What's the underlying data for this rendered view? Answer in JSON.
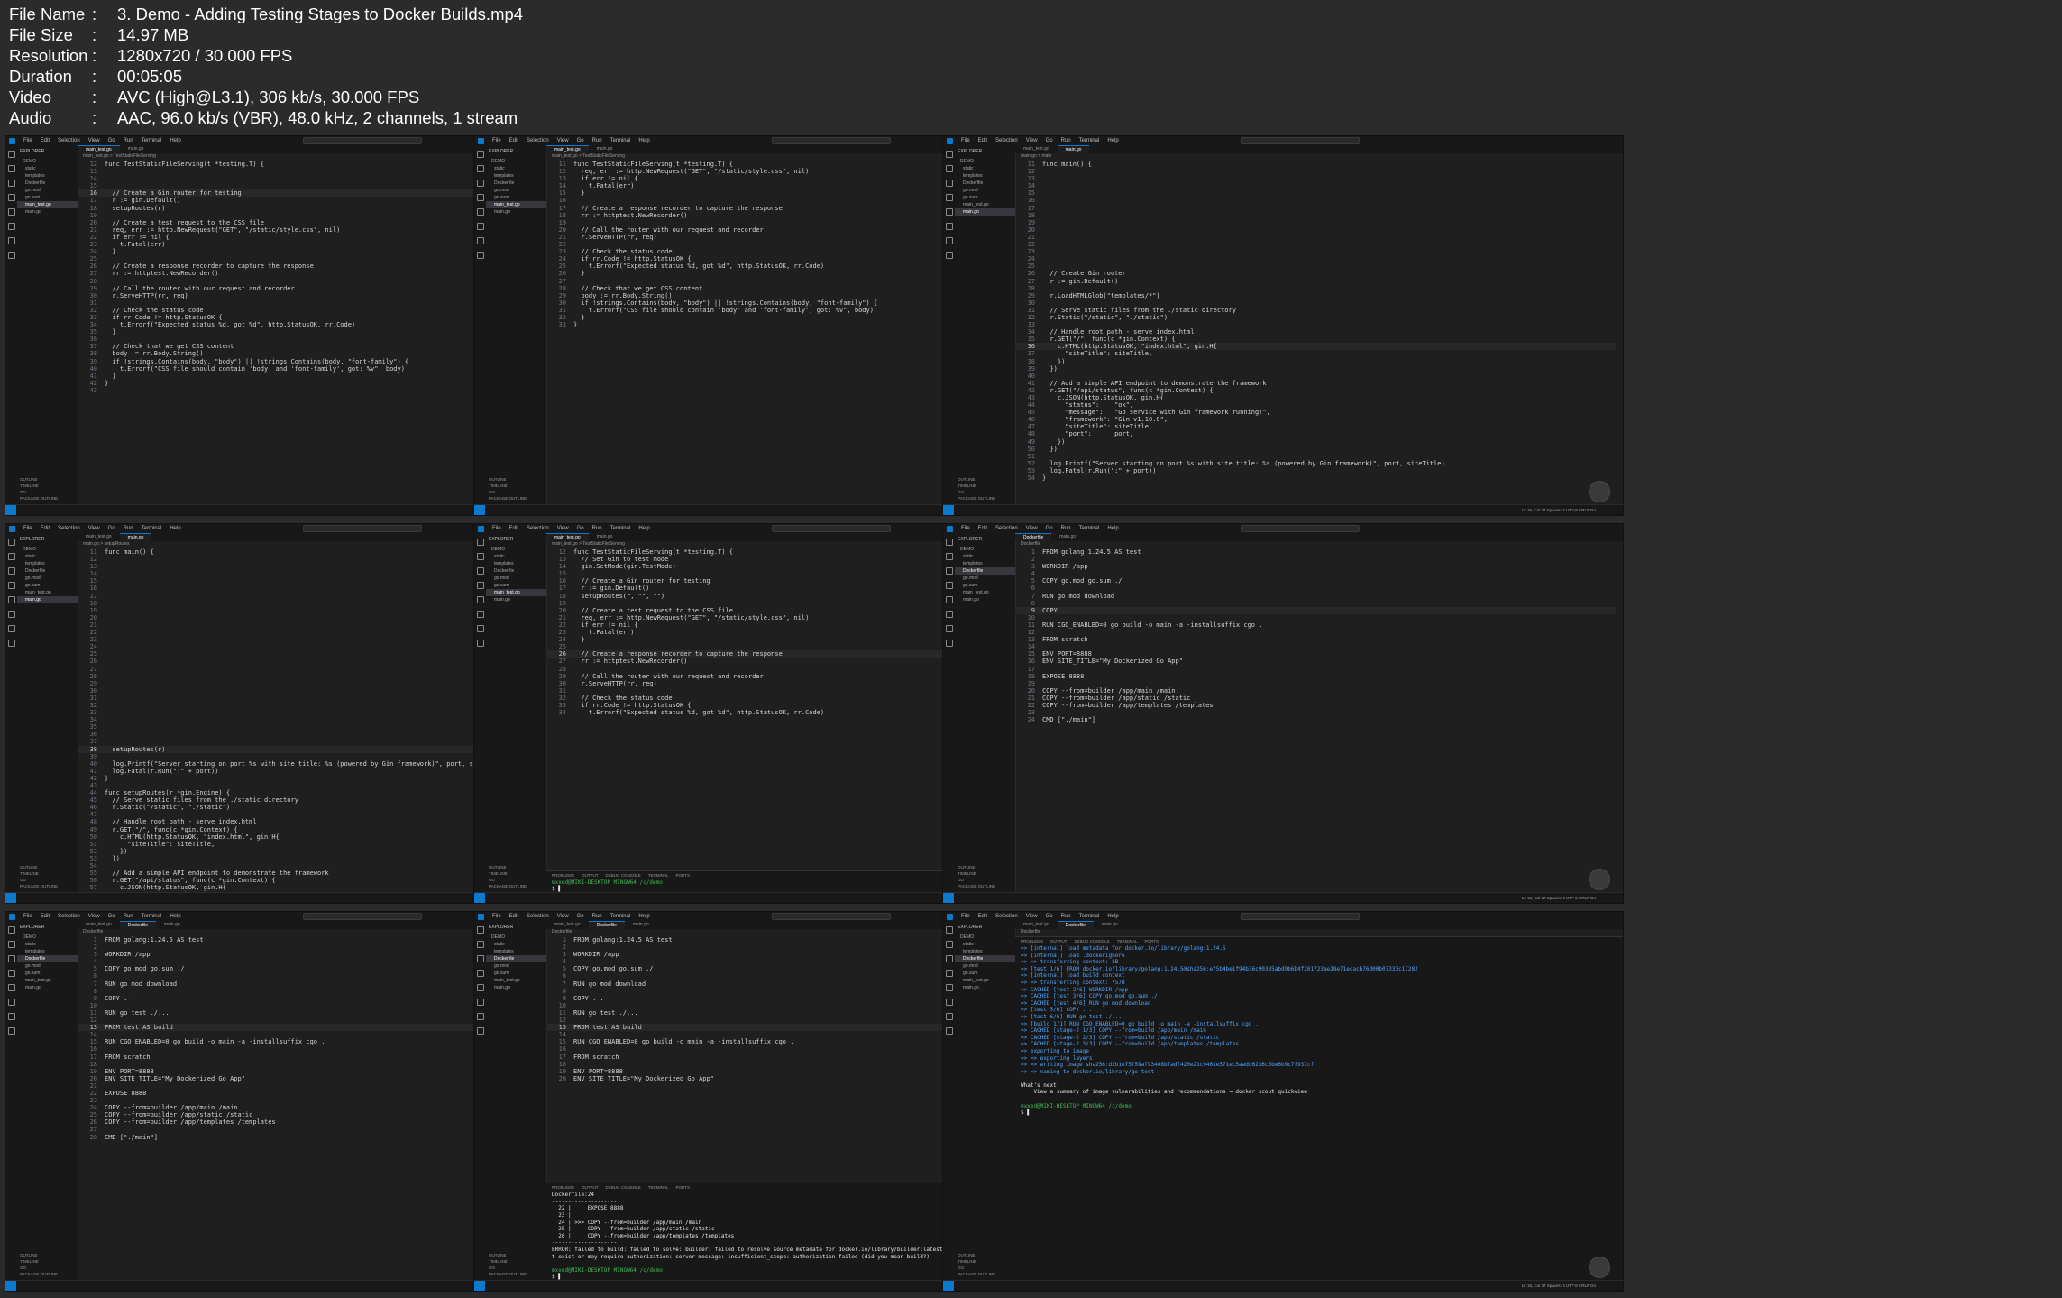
{
  "meta": [
    {
      "k": "File Name",
      "v": "3. Demo - Adding Testing Stages to Docker Builds.mp4"
    },
    {
      "k": "File Size",
      "v": "14.97 MB"
    },
    {
      "k": "Resolution",
      "v": "1280x720 / 30.000 FPS"
    },
    {
      "k": "Duration",
      "v": "00:05:05"
    },
    {
      "k": "Video",
      "v": "AVC (High@L3.1), 306 kb/s, 30.000 FPS"
    },
    {
      "k": "Audio",
      "v": "AAC, 96.0 kb/s (VBR), 48.0 kHz, 2 channels, 1 stream"
    }
  ],
  "frames": [
    {
      "tabs": [
        "main_test.go",
        "main.go"
      ],
      "active": 0,
      "bc": "main_test.go > TestStaticFileServing",
      "sel": "main_test.go",
      "start": 12,
      "hl": 16,
      "code": [
        "func TestStaticFileServing(t *testing.T) {",
        "",
        "",
        "",
        "  // Create a Gin router for testing",
        "  r := gin.Default()",
        "  setupRoutes(r)",
        "",
        "  // Create a test request to the CSS file",
        "  req, err := http.NewRequest(\"GET\", \"/static/style.css\", nil)",
        "  if err != nil {",
        "    t.Fatal(err)",
        "  }",
        "",
        "  // Create a response recorder to capture the response",
        "  rr := httptest.NewRecorder()",
        "",
        "  // Call the router with our request and recorder",
        "  r.ServeHTTP(rr, req)",
        "",
        "  // Check the status code",
        "  if rr.Code != http.StatusOK {",
        "    t.Errorf(\"Expected status %d, got %d\", http.StatusOK, rr.Code)",
        "  }",
        "",
        "  // Check that we get CSS content",
        "  body := rr.Body.String()",
        "  if !strings.Contains(body, \"body\") || !strings.Contains(body, \"font-family\") {",
        "    t.Errorf(\"CSS file should contain 'body' and 'font-family', got: %v\", body)",
        "  }",
        "}",
        ""
      ],
      "term": []
    },
    {
      "tabs": [
        "main_test.go",
        "main.go"
      ],
      "active": 0,
      "bc": "main_test.go > TestStaticFileServing",
      "sel": "main_test.go",
      "start": 11,
      "hl": 0,
      "code": [
        "func TestStaticFileServing(t *testing.T) {",
        "  req, err := http.NewRequest(\"GET\", \"/static/style.css\", nil)",
        "  if err != nil {",
        "    t.Fatal(err)",
        "  }",
        "",
        "  // Create a response recorder to capture the response",
        "  rr := httptest.NewRecorder()",
        "",
        "  // Call the router with our request and recorder",
        "  r.ServeHTTP(rr, req)",
        "",
        "  // Check the status code",
        "  if rr.Code != http.StatusOK {",
        "    t.Errorf(\"Expected status %d, got %d\", http.StatusOK, rr.Code)",
        "  }",
        "",
        "  // Check that we get CSS content",
        "  body := rr.Body.String()",
        "  if !strings.Contains(body, \"body\") || !strings.Contains(body, \"font-family\") {",
        "    t.Errorf(\"CSS file should contain 'body' and 'font-family', got: %v\", body)",
        "  }",
        "}"
      ],
      "term": []
    },
    {
      "tabs": [
        "main_test.go",
        "main.go"
      ],
      "active": 1,
      "bc": "main.go > main",
      "sel": "main.go",
      "start": 11,
      "hl": 36,
      "code": [
        "func main() {",
        "",
        "",
        "",
        "",
        "",
        "",
        "",
        "",
        "",
        "",
        "",
        "",
        "",
        "",
        "  // Create Gin router",
        "  r := gin.Default()",
        "",
        "  r.LoadHTMLGlob(\"templates/*\")",
        "",
        "  // Serve static files from the ./static directory",
        "  r.Static(\"/static\", \"./static\")",
        "",
        "  // Handle root path - serve index.html",
        "  r.GET(\"/\", func(c *gin.Context) {",
        "    c.HTML(http.StatusOK, \"index.html\", gin.H{",
        "      \"siteTitle\": siteTitle,",
        "    })",
        "  })",
        "",
        "  // Add a simple API endpoint to demonstrate the framework",
        "  r.GET(\"/api/status\", func(c *gin.Context) {",
        "    c.JSON(http.StatusOK, gin.H{",
        "      \"status\":    \"ok\",",
        "      \"message\":   \"Go service with Gin framework running!\",",
        "      \"framework\": \"Gin v1.10.0\",",
        "      \"siteTitle\": siteTitle,",
        "      \"port\":      port,",
        "    })",
        "  })",
        "",
        "  log.Printf(\"Server starting on port %s with site title: %s (powered by Gin framework)\", port, siteTitle)",
        "  log.Fatal(r.Run(\":\" + port))",
        "}"
      ],
      "term": []
    },
    {
      "tabs": [
        "main_test.go",
        "main.go"
      ],
      "active": 1,
      "bc": "main.go > setupRoutes",
      "sel": "main.go",
      "start": 11,
      "hl": 38,
      "code": [
        "func main() {",
        "",
        "",
        "",
        "",
        "",
        "",
        "",
        "",
        "",
        "",
        "",
        "",
        "",
        "",
        "",
        "",
        "",
        "",
        "",
        "",
        "",
        "",
        "",
        "",
        "",
        "",
        "  setupRoutes(r)",
        "",
        "  log.Printf(\"Server starting on port %s with site title: %s (powered by Gin framework)\", port, siteTitle)",
        "  log.Fatal(r.Run(\":\" + port))",
        "}",
        "",
        "func setupRoutes(r *gin.Engine) {",
        "  // Serve static files from the ./static directory",
        "  r.Static(\"/static\", \"./static\")",
        "",
        "  // Handle root path - serve index.html",
        "  r.GET(\"/\", func(c *gin.Context) {",
        "    c.HTML(http.StatusOK, \"index.html\", gin.H{",
        "      \"siteTitle\": siteTitle,",
        "    })",
        "  })",
        "",
        "  // Add a simple API endpoint to demonstrate the framework",
        "  r.GET(\"/api/status\", func(c *gin.Context) {",
        "    c.JSON(http.StatusOK, gin.H{",
        "      \"status\":    \"ok\",",
        "      \"message\":   \"Go service with Gin framework running!\",",
        "      \"framework\": \"Gin v1.10.0\",",
        "      \"siteTitle\": siteTitle,",
        "      \"port\":      port,",
        "    })",
        "  })",
        "}"
      ],
      "term": []
    },
    {
      "tabs": [
        "main_test.go",
        "main.go"
      ],
      "active": 0,
      "bc": "main_test.go > TestStaticFileServing",
      "sel": "main_test.go",
      "start": 12,
      "hl": 26,
      "code": [
        "func TestStaticFileServing(t *testing.T) {",
        "  // Set Gin to test mode",
        "  gin.SetMode(gin.TestMode)",
        "",
        "  // Create a Gin router for testing",
        "  r := gin.Default()",
        "  setupRoutes(r, \"\", \"\")",
        "",
        "  // Create a test request to the CSS file",
        "  req, err := http.NewRequest(\"GET\", \"/static/style.css\", nil)",
        "  if err != nil {",
        "    t.Fatal(err)",
        "  }",
        "",
        "  // Create a response recorder to capture the response",
        "  rr := httptest.NewRecorder()",
        "",
        "  // Call the router with our request and recorder",
        "  r.ServeHTTP(rr, req)",
        "",
        "  // Check the status code",
        "  if rr.Code != http.StatusOK {",
        "    t.Errorf(\"Expected status %d, got %d\", http.StatusOK, rr.Code)"
      ],
      "term": [
        {
          "c": "g",
          "t": "mxxed@MIKI-DESKTOP MINGW64 /c/demo"
        },
        {
          "c": "r",
          "t": "$ ▌"
        }
      ]
    },
    {
      "tabs": [
        "Dockerfile",
        "main.go"
      ],
      "active": 0,
      "bc": "Dockerfile",
      "sel": "Dockerfile",
      "start": 1,
      "hl": 9,
      "code": [
        "FROM golang:1.24.5 AS test",
        "",
        "WORKDIR /app",
        "",
        "COPY go.mod go.sum ./",
        "",
        "RUN go mod download",
        "",
        "COPY . .",
        "",
        "RUN CGO_ENABLED=0 go build -o main -a -installsuffix cgo .",
        "",
        "FROM scratch",
        "",
        "ENV PORT=8888",
        "ENV SITE_TITLE=\"My Dockerized Go App\"",
        "",
        "EXPOSE 8888",
        "",
        "COPY --from=builder /app/main /main",
        "COPY --from=builder /app/static /static",
        "COPY --from=builder /app/templates /templates",
        "",
        "CMD [\"./main\"]"
      ],
      "term": []
    },
    {
      "tabs": [
        "main_test.go",
        "Dockerfile",
        "main.go"
      ],
      "active": 1,
      "bc": "Dockerfile",
      "sel": "Dockerfile",
      "start": 1,
      "hl": 13,
      "code": [
        "FROM golang:1.24.5 AS test",
        "",
        "WORKDIR /app",
        "",
        "COPY go.mod go.sum ./",
        "",
        "RUN go mod download",
        "",
        "COPY . .",
        "",
        "RUN go test ./...",
        "",
        "FROM test AS build",
        "",
        "RUN CGO_ENABLED=0 go build -o main -a -installsuffix cgo .",
        "",
        "FROM scratch",
        "",
        "ENV PORT=8888",
        "ENV SITE_TITLE=\"My Dockerized Go App\"",
        "",
        "EXPOSE 8888",
        "",
        "COPY --from=builder /app/main /main",
        "COPY --from=builder /app/static /static",
        "COPY --from=builder /app/templates /templates",
        "",
        "CMD [\"./main\"]"
      ],
      "term": []
    },
    {
      "tabs": [
        "main_test.go",
        "Dockerfile",
        "main.go"
      ],
      "active": 1,
      "bc": "Dockerfile",
      "sel": "Dockerfile",
      "start": 1,
      "hl": 13,
      "code": [
        "FROM golang:1.24.5 AS test",
        "",
        "WORKDIR /app",
        "",
        "COPY go.mod go.sum ./",
        "",
        "RUN go mod download",
        "",
        "COPY . .",
        "",
        "RUN go test ./...",
        "",
        "FROM test AS build",
        "",
        "RUN CGO_ENABLED=0 go build -o main -a -installsuffix cgo .",
        "",
        "FROM scratch",
        "",
        "ENV PORT=8888",
        "ENV SITE_TITLE=\"My Dockerized Go App\""
      ],
      "term": [
        {
          "c": "r",
          "t": "Dockerfile:24"
        },
        {
          "c": "r",
          "t": "--------------------"
        },
        {
          "c": "r",
          "t": "  22 |     EXPOSE 8888"
        },
        {
          "c": "r",
          "t": "  23 |"
        },
        {
          "c": "r",
          "t": "  24 | >>> COPY --from=builder /app/main /main"
        },
        {
          "c": "r",
          "t": "  25 |     COPY --from=builder /app/static /static"
        },
        {
          "c": "r",
          "t": "  26 |     COPY --from=builder /app/templates /templates"
        },
        {
          "c": "r",
          "t": "--------------------"
        },
        {
          "c": "r",
          "t": "ERROR: failed to build: failed to solve: builder: failed to resolve source metadata for docker.io/library/builder:latest: pull access denied, repository does no"
        },
        {
          "c": "r",
          "t": "t exist or may require authorization: server message: insufficient_scope: authorization failed (did you mean build?)"
        },
        {
          "c": "r",
          "t": ""
        },
        {
          "c": "g",
          "t": "mxxed@MIKI-DESKTOP MINGW64 /c/demo"
        },
        {
          "c": "r",
          "t": "$ ▌"
        }
      ]
    },
    {
      "tabs": [
        "main_test.go",
        "Dockerfile",
        "main.go"
      ],
      "active": 1,
      "bc": "Dockerfile",
      "sel": "Dockerfile",
      "start": 1,
      "hl": 0,
      "code": [],
      "term": [
        {
          "c": "c",
          "t": "=> [internal] load metadata for docker.io/library/golang:1.24.5"
        },
        {
          "c": "c",
          "t": "=> [internal] load .dockerignore"
        },
        {
          "c": "c",
          "t": "=> => transferring context: 2B"
        },
        {
          "c": "c",
          "t": "=> [test 1/6] FROM docker.io/library/golang:1.24.5@sha256:ef5b4be1f94b36c90385abd9b6b4f201723ae28e71ecacb76d00b07333c17282"
        },
        {
          "c": "c",
          "t": "=> [internal] load build context"
        },
        {
          "c": "c",
          "t": "=> => transferring context: 757B"
        },
        {
          "c": "c",
          "t": "=> CACHED [test 2/6] WORKDIR /app"
        },
        {
          "c": "c",
          "t": "=> CACHED [test 3/6] COPY go.mod go.sum ./"
        },
        {
          "c": "c",
          "t": "=> CACHED [test 4/6] RUN go mod download"
        },
        {
          "c": "c",
          "t": "=> [test 5/6] COPY . ."
        },
        {
          "c": "c",
          "t": "=> [test 6/6] RUN go test ./..."
        },
        {
          "c": "c",
          "t": "=> [build 1/1] RUN CGO_ENABLED=0 go build -o main -a -installsuffix cgo ."
        },
        {
          "c": "c",
          "t": "=> CACHED [stage-2 1/3] COPY --from=build /app/main /main"
        },
        {
          "c": "c",
          "t": "=> CACHED [stage-2 2/3] COPY --from=build /app/static /static"
        },
        {
          "c": "c",
          "t": "=> CACHED [stage-2 3/3] COPY --from=build /app/templates /templates"
        },
        {
          "c": "c",
          "t": "=> exporting to image"
        },
        {
          "c": "c",
          "t": "=> => exporting layers"
        },
        {
          "c": "c",
          "t": "=> => writing image sha256:d2b1e75f59af93408bfadf420e21c9461e571ec5aadd6236c3be6b9c7f937cf"
        },
        {
          "c": "c",
          "t": "=> => naming to docker.io/library/go-test"
        },
        {
          "c": "r",
          "t": ""
        },
        {
          "c": "r",
          "t": "What's next:"
        },
        {
          "c": "r",
          "t": "    View a summary of image vulnerabilities and recommendations → docker scout quickview"
        },
        {
          "c": "r",
          "t": ""
        },
        {
          "c": "g",
          "t": "mxxed@MIKI-DESKTOP MINGW64 /c/demo"
        },
        {
          "c": "r",
          "t": "$ ▌"
        }
      ]
    }
  ],
  "menu": [
    "File",
    "Edit",
    "Selection",
    "View",
    "Go",
    "Run",
    "Terminal",
    "Help"
  ],
  "search": "demo",
  "explorer": {
    "title": "EXPLORER",
    "root": "DEMO",
    "items": [
      "static",
      "templates",
      "Dockerfile",
      "go.mod",
      "go.sum",
      "main_test.go",
      "main.go"
    ]
  },
  "outline": [
    "OUTLINE",
    "TIMELINE",
    "GO",
    "PACKAGE OUTLINE"
  ],
  "termTabs": [
    "PROBLEMS",
    "OUTPUT",
    "DEBUG CONSOLE",
    "TERMINAL",
    "PORTS"
  ],
  "status": "Ln 16, Col 37   Spaces: 4   UTF-8   CRLF   Go"
}
